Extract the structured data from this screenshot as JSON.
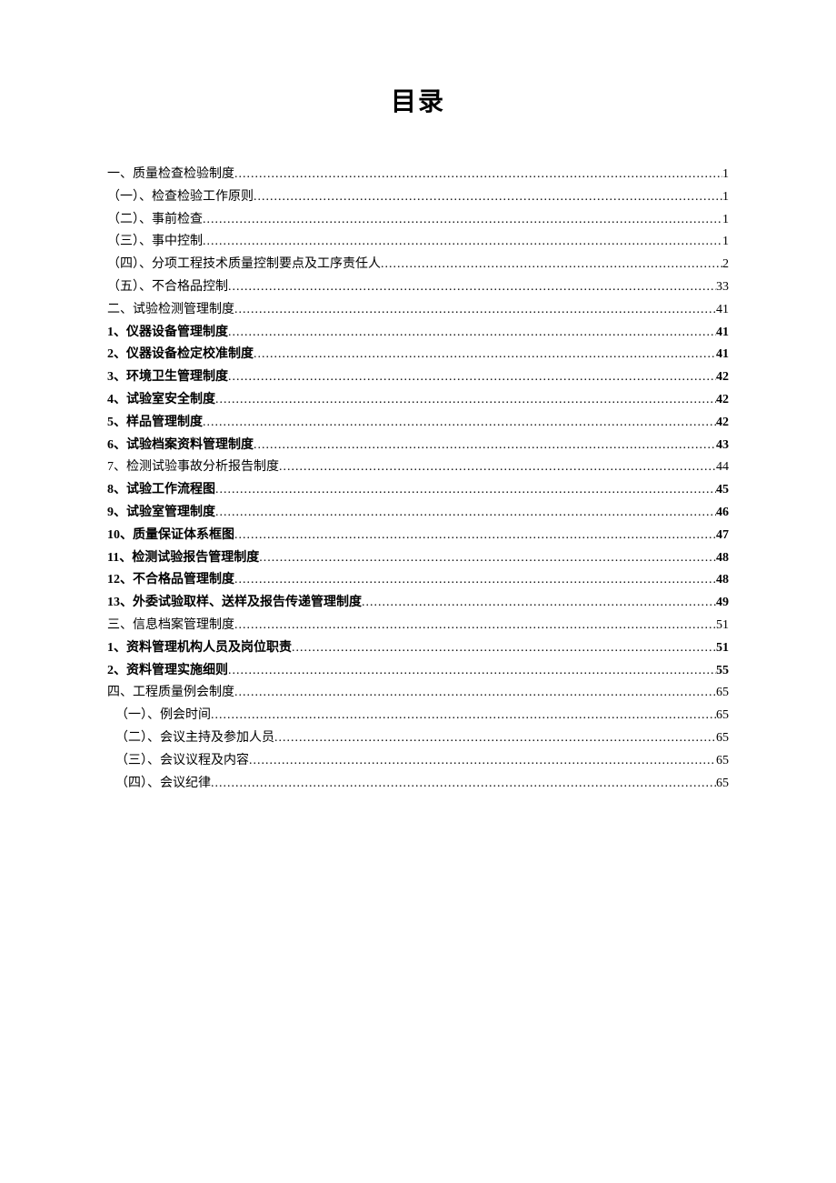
{
  "title": "目录",
  "toc": [
    {
      "label": "一、质量检查检验制度",
      "page": "1",
      "indent": false,
      "bold": false
    },
    {
      "label": "（一）、检查检验工作原则",
      "page": "1",
      "indent": false,
      "bold": false
    },
    {
      "label": "（二）、事前检查",
      "page": "1",
      "indent": false,
      "bold": false
    },
    {
      "label": "（三）、事中控制",
      "page": "1",
      "indent": false,
      "bold": false
    },
    {
      "label": "（四）、分项工程技术质量控制要点及工序责任人",
      "page": "2",
      "indent": false,
      "bold": false
    },
    {
      "label": "（五）、不合格品控制",
      "page": "33",
      "indent": false,
      "bold": false
    },
    {
      "label": "二、试验检测管理制度",
      "page": "41",
      "indent": false,
      "bold": false
    },
    {
      "label": "1、仪器设备管理制度",
      "page": "41",
      "indent": false,
      "bold": true
    },
    {
      "label": "2、仪器设备检定校准制度",
      "page": "41",
      "indent": false,
      "bold": true
    },
    {
      "label": "3、环境卫生管理制度",
      "page": "42",
      "indent": false,
      "bold": true
    },
    {
      "label": "4、试验室安全制度",
      "page": "42",
      "indent": false,
      "bold": true
    },
    {
      "label": "5、样品管理制度",
      "page": "42",
      "indent": false,
      "bold": true
    },
    {
      "label": "6、试验档案资料管理制度",
      "page": "43",
      "indent": false,
      "bold": true
    },
    {
      "label": "7、检测试验事故分析报告制度 ",
      "page": "44",
      "indent": false,
      "bold": false
    },
    {
      "label": "8、试验工作流程图",
      "page": "45",
      "indent": false,
      "bold": true
    },
    {
      "label": "9、试验室管理制度",
      "page": "46",
      "indent": false,
      "bold": true
    },
    {
      "label": "10、质量保证体系框图",
      "page": "47",
      "indent": false,
      "bold": true
    },
    {
      "label": "11、检测试验报告管理制度",
      "page": "48",
      "indent": false,
      "bold": true
    },
    {
      "label": "12、不合格品管理制度",
      "page": "48",
      "indent": false,
      "bold": true
    },
    {
      "label": "13、外委试验取样、送样及报告传递管理制度",
      "page": "49",
      "indent": false,
      "bold": true
    },
    {
      "label": "三、信息档案管理制度",
      "page": "51",
      "indent": false,
      "bold": false
    },
    {
      "label": "1、资料管理机构人员及岗位职责",
      "page": "51",
      "indent": false,
      "bold": true
    },
    {
      "label": "2、资料管理实施细则",
      "page": "55",
      "indent": false,
      "bold": true
    },
    {
      "label": "四、工程质量例会制度",
      "page": "65",
      "indent": false,
      "bold": false
    },
    {
      "label": "（一）、例会时间",
      "page": "65",
      "indent": true,
      "bold": false
    },
    {
      "label": "（二）、会议主持及参加人员",
      "page": "65",
      "indent": true,
      "bold": false
    },
    {
      "label": "（三）、会议议程及内容",
      "page": "65",
      "indent": true,
      "bold": false
    },
    {
      "label": "（四）、会议纪律",
      "page": "65",
      "indent": true,
      "bold": false
    }
  ]
}
